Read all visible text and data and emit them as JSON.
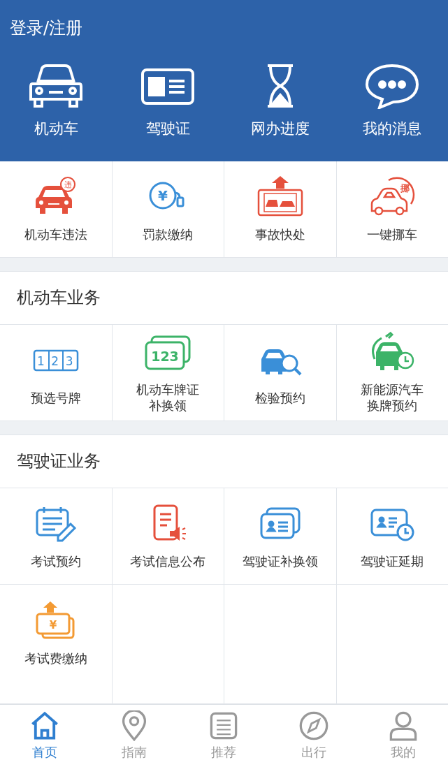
{
  "header": {
    "login": "登录/注册",
    "shortcuts": [
      {
        "label": "机动车"
      },
      {
        "label": "驾驶证"
      },
      {
        "label": "网办进度"
      },
      {
        "label": "我的消息"
      }
    ]
  },
  "quick_services": [
    {
      "label": "机动车违法",
      "icon_text": "违"
    },
    {
      "label": "罚款缴纳",
      "icon_text": "¥"
    },
    {
      "label": "事故快处"
    },
    {
      "label": "一键挪车",
      "icon_text": "挪"
    }
  ],
  "sections": [
    {
      "title": "机动车业务",
      "items": [
        {
          "label": "预选号牌",
          "icon_text": "123"
        },
        {
          "label_lines": [
            "机动车牌证",
            "补换领"
          ],
          "icon_text": "123"
        },
        {
          "label": "检验预约"
        },
        {
          "label_lines": [
            "新能源汽车",
            "换牌预约"
          ]
        }
      ]
    },
    {
      "title": "驾驶证业务",
      "items": [
        {
          "label": "考试预约"
        },
        {
          "label": "考试信息公布"
        },
        {
          "label": "驾驶证补换领"
        },
        {
          "label": "驾驶证延期"
        },
        {
          "label": "考试费缴纳",
          "icon_text": "¥"
        }
      ]
    }
  ],
  "tabs": [
    {
      "label": "首页",
      "selected": true
    },
    {
      "label": "指南",
      "selected": false
    },
    {
      "label": "推荐",
      "selected": false
    },
    {
      "label": "出行",
      "selected": false
    },
    {
      "label": "我的",
      "selected": false
    }
  ]
}
